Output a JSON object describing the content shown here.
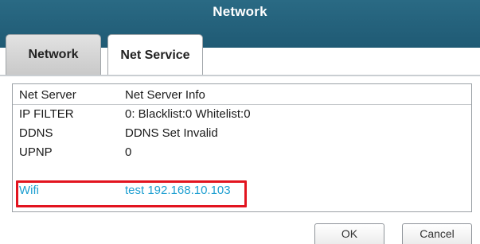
{
  "window": {
    "title": "Network"
  },
  "tabs": [
    {
      "label": "Network",
      "active": false
    },
    {
      "label": "Net Service",
      "active": true
    }
  ],
  "list": {
    "headers": [
      "Net Server",
      "Net Server Info"
    ],
    "rows": [
      {
        "server": "IP FILTER",
        "info": "0: Blacklist:0 Whitelist:0"
      },
      {
        "server": "DDNS",
        "info": "DDNS Set Invalid"
      },
      {
        "server": "UPNP",
        "info": "0"
      },
      {
        "server": "Wifi",
        "info": "test 192.168.10.103",
        "selected": true
      }
    ]
  },
  "buttons": {
    "ok": "OK",
    "cancel": "Cancel"
  },
  "colors": {
    "titlebar": "#1f5a74",
    "selected_row_text": "#1e9fd1",
    "annotation_box": "#e2141f"
  }
}
